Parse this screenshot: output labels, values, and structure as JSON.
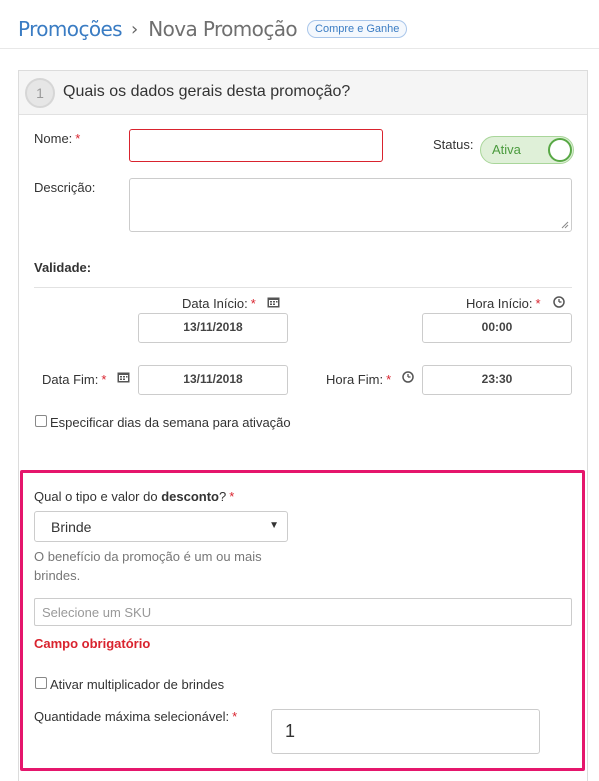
{
  "breadcrumb": {
    "root": "Promoções",
    "separator": "›",
    "current": "Nova Promoção",
    "badge": "Compre e Ganhe"
  },
  "step": {
    "number": "1",
    "title": "Quais os dados gerais desta promoção?"
  },
  "form": {
    "name": {
      "label": "Nome:",
      "required": "*",
      "value": ""
    },
    "status": {
      "label": "Status:",
      "toggle_text": "Ativa",
      "enabled": true
    },
    "description": {
      "label": "Descrição:",
      "value": ""
    },
    "validity": {
      "title": "Validade:",
      "start_date": {
        "label": "Data Início:",
        "required": "*",
        "value": "13/11/2018"
      },
      "start_time": {
        "label": "Hora Início:",
        "required": "*",
        "value": "00:00"
      },
      "end_date": {
        "label": "Data Fim:",
        "required": "*",
        "value": "13/11/2018"
      },
      "end_time": {
        "label": "Hora Fim:",
        "required": "*",
        "value": "23:30"
      }
    },
    "weekdays_checkbox": {
      "label": "Especificar dias da semana para ativação",
      "checked": false
    }
  },
  "discount": {
    "question_prefix": "Qual o tipo e valor do ",
    "question_bold": "desconto",
    "question_suffix": "?",
    "required": "*",
    "type_value": "Brinde",
    "help_text": "O benefício da promoção é um ou mais brindes.",
    "sku_placeholder": "Selecione um SKU",
    "error": "Campo obrigatório",
    "multiplier_checkbox": {
      "label": "Ativar multiplicador de brindes",
      "checked": false
    },
    "max_qty": {
      "label": "Quantidade máxima selecionável:",
      "required": "*",
      "value": "1"
    }
  },
  "colors": {
    "link": "#3a7cc3",
    "required": "#d9232e",
    "toggle_on": "#58a845",
    "highlight_border": "#e5166c"
  },
  "icons": {
    "calendar": "calendar-icon",
    "clock": "clock-icon"
  }
}
